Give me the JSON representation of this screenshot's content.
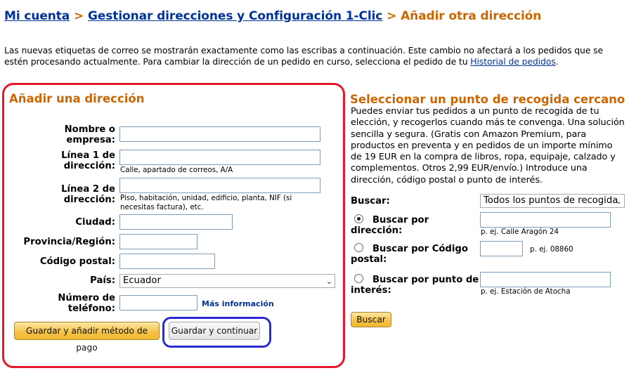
{
  "breadcrumb": {
    "items": [
      "Mi cuenta",
      "Gestionar direcciones y Configuración 1-Clic"
    ],
    "separator": ">",
    "current": "Añadir otra dirección"
  },
  "intro": {
    "text": "Las nuevas etiquetas de correo se mostrarán exactamente como las escribas a continuación. Este cambio no afectará a los pedidos que se estén procesando actualmente. Para cambiar la dirección de un pedido en curso, selecciona el pedido de tu ",
    "link": "Historial de pedidos",
    "end": "."
  },
  "add_address": {
    "title": "Añadir una dirección",
    "fields": {
      "name": {
        "label1": "Nombre o",
        "label2": "empresa:",
        "value": ""
      },
      "line1": {
        "label1": "Línea 1 de",
        "label2": "dirección:",
        "value": "",
        "hint": "Calle, apartado de correos, A/A"
      },
      "line2": {
        "label1": "Línea 2 de",
        "label2": "dirección:",
        "value": "",
        "hint1": "Piso, habitación, unidad, edificio, planta, NIF (si",
        "hint2": "necesitas factura), etc."
      },
      "city": {
        "label": "Ciudad:",
        "value": ""
      },
      "province": {
        "label": "Provincia/Región:",
        "value": ""
      },
      "postal": {
        "label": "Código postal:",
        "value": ""
      },
      "country": {
        "label": "País:",
        "value": "Ecuador"
      },
      "phone": {
        "label1": "Número de",
        "label2": "teléfono:",
        "value": "",
        "more_info": "Más información"
      }
    },
    "buttons": {
      "save_payment": "Guardar y añadir método de pago",
      "save_continue": "Guardar y continuar"
    }
  },
  "pickup": {
    "title": "Seleccionar un punto de recogida cercano",
    "description": "Puedes enviar tus pedidos a un punto de recogida de tu elección, y recogerlos cuando más te convenga. Una solución sencilla y segura. (Gratis con Amazon Premium, para productos en preventa y en pedidos de un importe mínimo de 19 EUR en la compra de libros, ropa, equipaje, calzado y complementos. Otros 2,99 EUR/envío.) Introduce una dirección, código postal o punto de interés.",
    "search_label": "Buscar:",
    "search_select": "Todos los puntos de recogida",
    "options": {
      "address": {
        "label1": "Buscar por",
        "label2": "dirección:",
        "value": "",
        "hint": "p. ej. Calle Aragón 24",
        "selected": true
      },
      "postal": {
        "label1": "Buscar por Código",
        "label2": "postal:",
        "value": "",
        "hint": "p. ej. 08860",
        "selected": false
      },
      "poi": {
        "label1": "Buscar por punto de",
        "label2": "interés:",
        "value": "",
        "hint": "p. ej. Estación de Atocha",
        "selected": false
      }
    },
    "search_button": "Buscar"
  },
  "colors": {
    "link": "#003399",
    "heading_orange": "#cc6600",
    "highlight_red": "#e4192a",
    "highlight_blue": "#2b2bd6"
  }
}
